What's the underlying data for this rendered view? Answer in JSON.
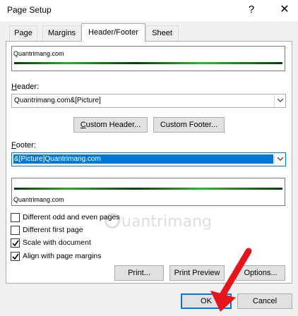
{
  "window": {
    "title": "Page Setup",
    "help": "?",
    "close": "✕"
  },
  "tabs": [
    {
      "label": "Page"
    },
    {
      "label": "Margins"
    },
    {
      "label": "Header/Footer"
    },
    {
      "label": "Sheet"
    }
  ],
  "header_preview": {
    "text": "Quantrimang.com"
  },
  "header": {
    "label_prefix": "",
    "label_key": "H",
    "label_rest": "eader:",
    "value": "Quantrimang.com&[Picture]"
  },
  "buttons": {
    "custom_header_key": "C",
    "custom_header_rest": "ustom Header...",
    "custom_footer_key": "",
    "custom_footer_full": "Custom Footer...",
    "print": "Print...",
    "print_preview": "Print Preview",
    "options": "Options...",
    "ok": "OK",
    "cancel": "Cancel"
  },
  "footer": {
    "label_key": "F",
    "label_rest": "ooter:",
    "value": "&[Picture]Quantrimang.com"
  },
  "footer_preview": {
    "text": "Quantrimang.com"
  },
  "options": [
    {
      "label": "Different odd and even pages",
      "checked": false
    },
    {
      "label": "Different first page",
      "checked": false
    },
    {
      "label": "Scale with document",
      "checked": true
    },
    {
      "label": "Align with page margins",
      "checked": true
    }
  ],
  "watermark": {
    "text": "uantrimang"
  },
  "colors": {
    "accent": "#0078d7",
    "arrow": "#e8141c"
  }
}
